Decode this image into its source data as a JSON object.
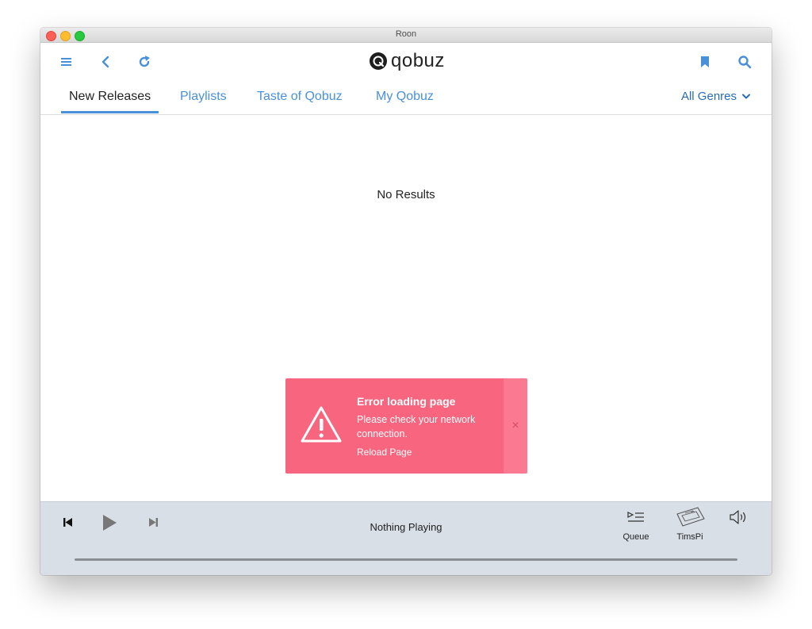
{
  "window": {
    "title": "Roon"
  },
  "toolbar": {
    "menu_icon": "menu-icon",
    "back_icon": "back-icon",
    "refresh_icon": "refresh-icon",
    "bookmark_icon": "bookmark-icon",
    "search_icon": "search-icon"
  },
  "logo": {
    "text": "qobuz"
  },
  "tabs": [
    {
      "label": "New Releases",
      "active": true
    },
    {
      "label": "Playlists",
      "active": false
    },
    {
      "label": "Taste of Qobuz",
      "active": false
    },
    {
      "label": "My Qobuz",
      "active": false
    }
  ],
  "genre_filter": {
    "label": "All Genres"
  },
  "content": {
    "empty_text": "No Results"
  },
  "error_toast": {
    "title": "Error loading page",
    "body": "Please check your network connection.",
    "action": "Reload Page",
    "close_glyph": "×",
    "color": "#f8657f"
  },
  "player": {
    "now_playing": "Nothing Playing",
    "queue_label": "Queue",
    "zone_label": "TimsPi"
  },
  "colors": {
    "accent": "#4a90d9",
    "player_bg": "#d8dfe7"
  }
}
